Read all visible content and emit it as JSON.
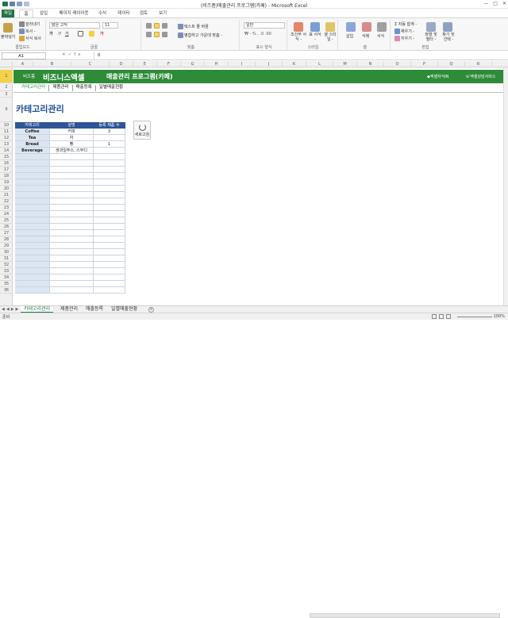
{
  "window": {
    "title": "(비즈폼)매출관리 프로그램(카페) - Microsoft Excel",
    "minimize": "—",
    "maximize": "□",
    "close": "✕"
  },
  "ribbon_tabs": [
    "파일",
    "홈",
    "삽입",
    "페이지 레이아웃",
    "수식",
    "데이터",
    "검토",
    "보기"
  ],
  "ribbon": {
    "clipboard": {
      "paste": "붙여넣기",
      "cut": "잘라내기",
      "copy": "복사 -",
      "format_painter": "서식 복사",
      "label": "클립보드"
    },
    "font": {
      "font_name": "맑은 고딕",
      "font_size": "11",
      "label": "글꼴"
    },
    "alignment": {
      "wrap": "텍스트 줄 바꿈",
      "merge": "병합하고 가운데 맞춤 -",
      "label": "맞춤"
    },
    "number": {
      "format": "일반",
      "label": "표시 형식"
    },
    "styles": {
      "conditional": "조건부 서식 -",
      "table": "표 서식 -",
      "cell": "셀 스타일 -",
      "label": "스타일"
    },
    "cells": {
      "insert": "삽입",
      "delete": "삭제",
      "format": "서식",
      "label": "셀"
    },
    "editing": {
      "autosum": "자동 합계 -",
      "fill": "채우기 -",
      "clear": "지우기 -",
      "sort": "정렬 및 필터 -",
      "find": "찾기 및 선택 -",
      "label": "편집"
    }
  },
  "formula_bar": {
    "name_box": "A1",
    "fx": "fx",
    "value": "0"
  },
  "columns": [
    "A",
    "B",
    "C",
    "D",
    "E",
    "F",
    "G",
    "H",
    "I",
    "J",
    "K",
    "L",
    "M",
    "N",
    "O",
    "P",
    "Q",
    "R"
  ],
  "rows": [
    "1",
    "2",
    "3",
    "9",
    "10",
    "11",
    "12",
    "13",
    "14",
    "15",
    "16",
    "17",
    "18",
    "19",
    "20",
    "21",
    "22",
    "23",
    "24",
    "25",
    "26",
    "27",
    "28",
    "29",
    "30",
    "31",
    "32",
    "33",
    "34",
    "35",
    "36"
  ],
  "header": {
    "brand_small": "비즈폼",
    "brand": "비즈니스엑셀",
    "app_title": "매출관리 프로그램(카페)",
    "link1": "◆엑셀자식IN",
    "link2": "☏엑셀상담서비스"
  },
  "nav": [
    "카테고리관리",
    "제품관리",
    "매출등록",
    "일별매출현황"
  ],
  "page_title": "카테고리관리",
  "table": {
    "headers": [
      "카테고리",
      "설명",
      "등록 제품 수"
    ],
    "rows": [
      [
        "Coffee",
        "커피",
        "3"
      ],
      [
        "Tea",
        "차",
        ""
      ],
      [
        "Bread",
        "빵",
        "1"
      ],
      [
        "Beverage",
        "생과일주스, 스무디",
        ""
      ]
    ],
    "empty_rows": 22
  },
  "refresh_button": "새로고침",
  "sheet_tabs": [
    "카테고리관리",
    "제품관리",
    "매출등록",
    "일별매출현황"
  ],
  "status": {
    "ready": "준비",
    "zoom": "100%"
  },
  "colors": {
    "green": "#2e8b38",
    "navy": "#2f5597",
    "excel_green": "#217346",
    "title_blue": "#1f4e9a"
  }
}
